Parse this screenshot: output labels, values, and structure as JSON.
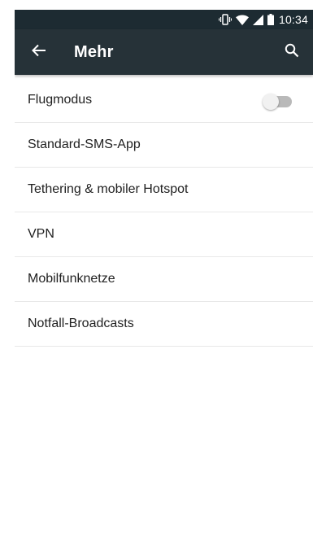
{
  "status_bar": {
    "time": "10:34",
    "icons": [
      "vibrate-icon",
      "wifi-icon",
      "signal-icon",
      "battery-icon"
    ]
  },
  "app_bar": {
    "title": "Mehr",
    "back_icon": "arrow-back-icon",
    "search_icon": "search-icon"
  },
  "settings": [
    {
      "label": "Flugmodus",
      "toggle": true,
      "toggle_on": false
    },
    {
      "label": "Standard-SMS-App"
    },
    {
      "label": "Tethering & mobiler Hotspot"
    },
    {
      "label": "VPN"
    },
    {
      "label": "Mobilfunknetze"
    },
    {
      "label": "Notfall-Broadcasts"
    }
  ],
  "colors": {
    "status_bar": "#1d2b32",
    "app_bar": "#263238",
    "background": "#ffffff",
    "text": "#212121",
    "divider": "#e8e8e8"
  }
}
